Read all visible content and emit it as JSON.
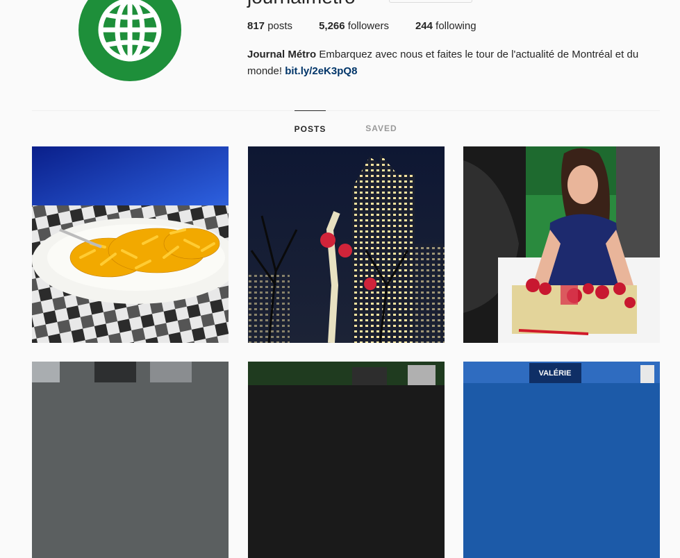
{
  "profile": {
    "username": "journalmetro",
    "avatar_icon": "globe-icon",
    "avatar_color": "#1e8f3a",
    "stats": {
      "posts_count": "817",
      "posts_label": "posts",
      "followers_count": "5,266",
      "followers_label": "followers",
      "following_count": "244",
      "following_label": "following"
    },
    "bio": {
      "name": "Journal Métro",
      "text": " Embarquez avec nous et faites le tour de l'actualité de Montréal et du monde! ",
      "link": "bit.ly/2eK3pQ8"
    }
  },
  "tabs": {
    "posts_label": "POSTS",
    "saved_label": "SAVED",
    "active": "POSTS"
  },
  "posts": [
    {
      "subject": "macaroni-and-cheese-plate"
    },
    {
      "subject": "skyscraper-night-lights"
    },
    {
      "subject": "woman-with-garland"
    },
    {
      "subject": "building-interior"
    },
    {
      "subject": "metro-sign"
    },
    {
      "subject": "campaign-sign"
    }
  ],
  "post_overlay_text": {
    "p6_sign": "VALÉRIE"
  }
}
